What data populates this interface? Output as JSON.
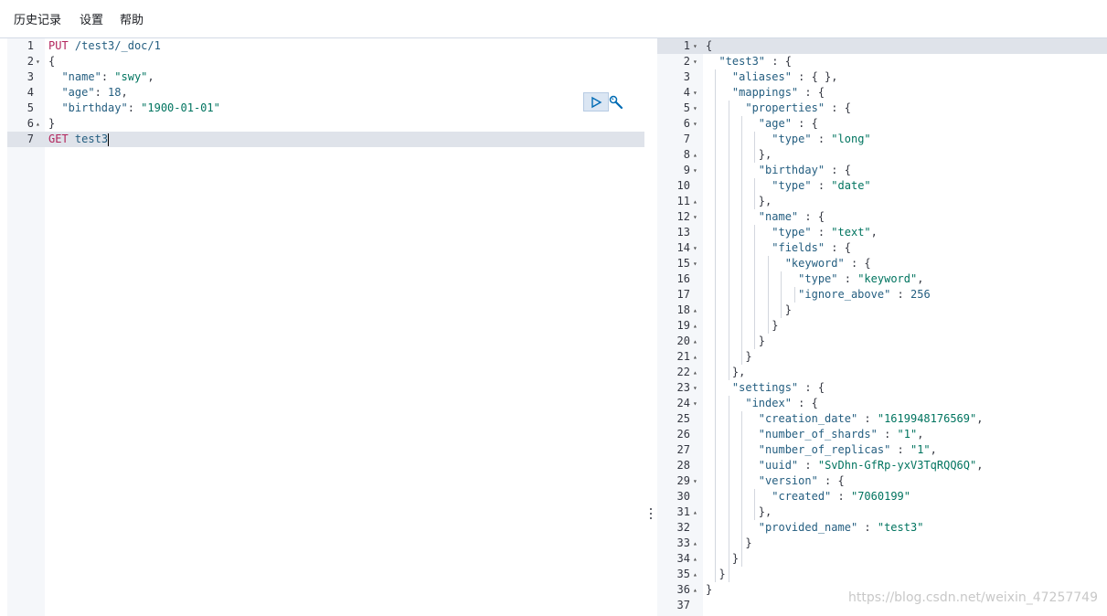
{
  "menu": {
    "history": "历史记录",
    "settings": "设置",
    "help": "帮助"
  },
  "request": {
    "lines": [
      [
        [
          "t-method",
          "PUT"
        ],
        [
          "t-plain",
          " "
        ],
        [
          "t-url",
          "/test3/_doc/1"
        ]
      ],
      [
        [
          "t-punc",
          "{"
        ]
      ],
      [
        [
          "t-plain",
          "  "
        ],
        [
          "t-key",
          "\"name\""
        ],
        [
          "t-punc",
          ": "
        ],
        [
          "t-str",
          "\"swy\""
        ],
        [
          "t-punc",
          ","
        ]
      ],
      [
        [
          "t-plain",
          "  "
        ],
        [
          "t-key",
          "\"age\""
        ],
        [
          "t-punc",
          ": "
        ],
        [
          "t-num",
          "18"
        ],
        [
          "t-punc",
          ","
        ]
      ],
      [
        [
          "t-plain",
          "  "
        ],
        [
          "t-key",
          "\"birthday\""
        ],
        [
          "t-punc",
          ": "
        ],
        [
          "t-str",
          "\"1900-01-01\""
        ]
      ],
      [
        [
          "t-punc",
          "}"
        ]
      ],
      [
        [
          "t-method",
          "GET"
        ],
        [
          "t-plain",
          " "
        ],
        [
          "t-url",
          "test3"
        ]
      ]
    ],
    "folds": {
      "2": "down",
      "6": "up"
    },
    "active_line": 7
  },
  "response": {
    "lines": [
      [
        [
          "t-punc",
          "{"
        ]
      ],
      [
        [
          "t-plain",
          "  "
        ],
        [
          "t-key",
          "\"test3\""
        ],
        [
          "t-punc",
          " : {"
        ]
      ],
      [
        [
          "t-plain",
          "    "
        ],
        [
          "t-key",
          "\"aliases\""
        ],
        [
          "t-punc",
          " : { },"
        ]
      ],
      [
        [
          "t-plain",
          "    "
        ],
        [
          "t-key",
          "\"mappings\""
        ],
        [
          "t-punc",
          " : {"
        ]
      ],
      [
        [
          "t-plain",
          "      "
        ],
        [
          "t-key",
          "\"properties\""
        ],
        [
          "t-punc",
          " : {"
        ]
      ],
      [
        [
          "t-plain",
          "        "
        ],
        [
          "t-key",
          "\"age\""
        ],
        [
          "t-punc",
          " : {"
        ]
      ],
      [
        [
          "t-plain",
          "          "
        ],
        [
          "t-key",
          "\"type\""
        ],
        [
          "t-punc",
          " : "
        ],
        [
          "t-str",
          "\"long\""
        ]
      ],
      [
        [
          "t-plain",
          "        "
        ],
        [
          "t-punc",
          "},"
        ]
      ],
      [
        [
          "t-plain",
          "        "
        ],
        [
          "t-key",
          "\"birthday\""
        ],
        [
          "t-punc",
          " : {"
        ]
      ],
      [
        [
          "t-plain",
          "          "
        ],
        [
          "t-key",
          "\"type\""
        ],
        [
          "t-punc",
          " : "
        ],
        [
          "t-str",
          "\"date\""
        ]
      ],
      [
        [
          "t-plain",
          "        "
        ],
        [
          "t-punc",
          "},"
        ]
      ],
      [
        [
          "t-plain",
          "        "
        ],
        [
          "t-key",
          "\"name\""
        ],
        [
          "t-punc",
          " : {"
        ]
      ],
      [
        [
          "t-plain",
          "          "
        ],
        [
          "t-key",
          "\"type\""
        ],
        [
          "t-punc",
          " : "
        ],
        [
          "t-str",
          "\"text\""
        ],
        [
          "t-punc",
          ","
        ]
      ],
      [
        [
          "t-plain",
          "          "
        ],
        [
          "t-key",
          "\"fields\""
        ],
        [
          "t-punc",
          " : {"
        ]
      ],
      [
        [
          "t-plain",
          "            "
        ],
        [
          "t-key",
          "\"keyword\""
        ],
        [
          "t-punc",
          " : {"
        ]
      ],
      [
        [
          "t-plain",
          "              "
        ],
        [
          "t-key",
          "\"type\""
        ],
        [
          "t-punc",
          " : "
        ],
        [
          "t-str",
          "\"keyword\""
        ],
        [
          "t-punc",
          ","
        ]
      ],
      [
        [
          "t-plain",
          "              "
        ],
        [
          "t-key",
          "\"ignore_above\""
        ],
        [
          "t-punc",
          " : "
        ],
        [
          "t-num",
          "256"
        ]
      ],
      [
        [
          "t-plain",
          "            "
        ],
        [
          "t-punc",
          "}"
        ]
      ],
      [
        [
          "t-plain",
          "          "
        ],
        [
          "t-punc",
          "}"
        ]
      ],
      [
        [
          "t-plain",
          "        "
        ],
        [
          "t-punc",
          "}"
        ]
      ],
      [
        [
          "t-plain",
          "      "
        ],
        [
          "t-punc",
          "}"
        ]
      ],
      [
        [
          "t-plain",
          "    "
        ],
        [
          "t-punc",
          "},"
        ]
      ],
      [
        [
          "t-plain",
          "    "
        ],
        [
          "t-key",
          "\"settings\""
        ],
        [
          "t-punc",
          " : {"
        ]
      ],
      [
        [
          "t-plain",
          "      "
        ],
        [
          "t-key",
          "\"index\""
        ],
        [
          "t-punc",
          " : {"
        ]
      ],
      [
        [
          "t-plain",
          "        "
        ],
        [
          "t-key",
          "\"creation_date\""
        ],
        [
          "t-punc",
          " : "
        ],
        [
          "t-str",
          "\"1619948176569\""
        ],
        [
          "t-punc",
          ","
        ]
      ],
      [
        [
          "t-plain",
          "        "
        ],
        [
          "t-key",
          "\"number_of_shards\""
        ],
        [
          "t-punc",
          " : "
        ],
        [
          "t-str",
          "\"1\""
        ],
        [
          "t-punc",
          ","
        ]
      ],
      [
        [
          "t-plain",
          "        "
        ],
        [
          "t-key",
          "\"number_of_replicas\""
        ],
        [
          "t-punc",
          " : "
        ],
        [
          "t-str",
          "\"1\""
        ],
        [
          "t-punc",
          ","
        ]
      ],
      [
        [
          "t-plain",
          "        "
        ],
        [
          "t-key",
          "\"uuid\""
        ],
        [
          "t-punc",
          " : "
        ],
        [
          "t-str",
          "\"SvDhn-GfRp-yxV3TqRQQ6Q\""
        ],
        [
          "t-punc",
          ","
        ]
      ],
      [
        [
          "t-plain",
          "        "
        ],
        [
          "t-key",
          "\"version\""
        ],
        [
          "t-punc",
          " : {"
        ]
      ],
      [
        [
          "t-plain",
          "          "
        ],
        [
          "t-key",
          "\"created\""
        ],
        [
          "t-punc",
          " : "
        ],
        [
          "t-str",
          "\"7060199\""
        ]
      ],
      [
        [
          "t-plain",
          "        "
        ],
        [
          "t-punc",
          "},"
        ]
      ],
      [
        [
          "t-plain",
          "        "
        ],
        [
          "t-key",
          "\"provided_name\""
        ],
        [
          "t-punc",
          " : "
        ],
        [
          "t-str",
          "\"test3\""
        ]
      ],
      [
        [
          "t-plain",
          "      "
        ],
        [
          "t-punc",
          "}"
        ]
      ],
      [
        [
          "t-plain",
          "    "
        ],
        [
          "t-punc",
          "}"
        ]
      ],
      [
        [
          "t-plain",
          "  "
        ],
        [
          "t-punc",
          "}"
        ]
      ],
      [
        [
          "t-punc",
          "}"
        ]
      ],
      []
    ],
    "folds": {
      "1": "down",
      "2": "down",
      "4": "down",
      "5": "down",
      "6": "down",
      "8": "up",
      "9": "down",
      "11": "up",
      "12": "down",
      "14": "down",
      "15": "down",
      "18": "up",
      "19": "up",
      "20": "up",
      "21": "up",
      "22": "up",
      "23": "down",
      "24": "down",
      "29": "down",
      "31": "up",
      "33": "up",
      "34": "up",
      "35": "up",
      "36": "up"
    },
    "active_line": 1
  },
  "watermark": "https://blog.csdn.net/weixin_47257749",
  "icons": {
    "run": "play-icon",
    "settings": "wrench-icon"
  }
}
